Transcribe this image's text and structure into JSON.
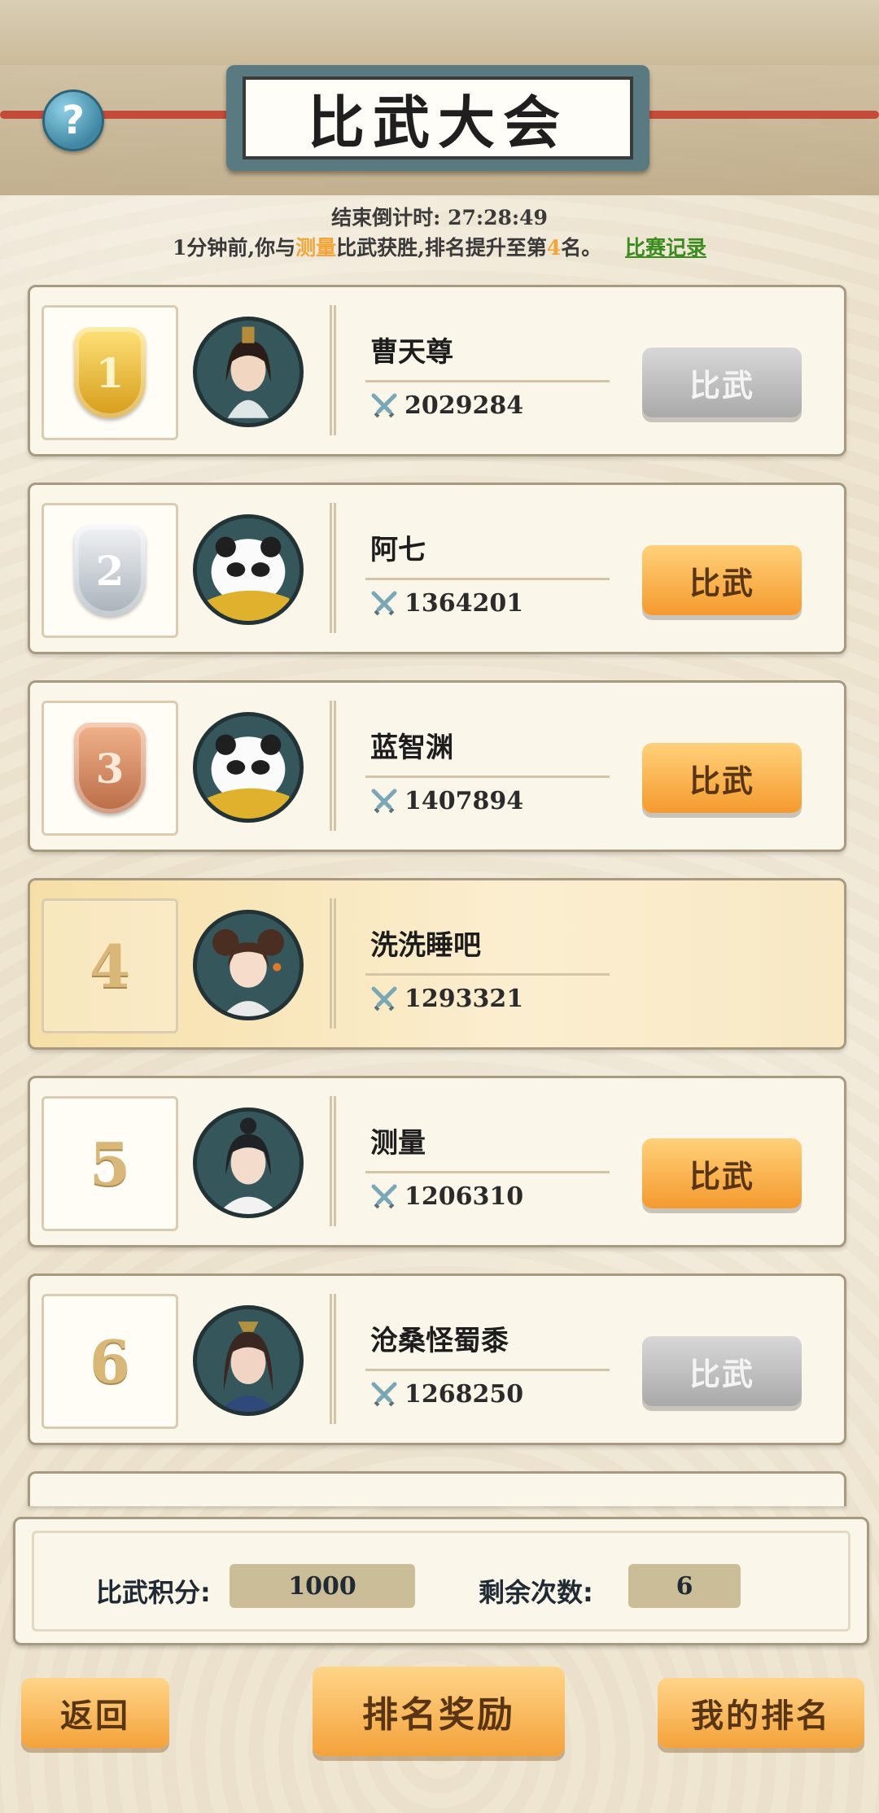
{
  "header": {
    "title": "比武大会",
    "help_icon": "?"
  },
  "countdown": {
    "label": "结束倒计时:",
    "time": "27:28:49"
  },
  "news": {
    "prefix": "1分钟前,你与",
    "opponent": "测量",
    "middle": "比武获胜,排名提升至第",
    "rank": "4",
    "suffix": "名。",
    "link": "比赛记录"
  },
  "ranking": [
    {
      "rank": "1",
      "medal": "gold",
      "name": "曹天尊",
      "power": "2029284",
      "button": "比武",
      "button_state": "disabled",
      "avatar": "swordsman-topknot"
    },
    {
      "rank": "2",
      "medal": "silver",
      "name": "阿七",
      "power": "1364201",
      "button": "比武",
      "button_state": "active",
      "avatar": "panda-yellow-scarf"
    },
    {
      "rank": "3",
      "medal": "bronze",
      "name": "蓝智渊",
      "power": "1407894",
      "button": "比武",
      "button_state": "active",
      "avatar": "panda-yellow-scarf"
    },
    {
      "rank": "4",
      "medal": "none",
      "name": "洗洗睡吧",
      "power": "1293321",
      "button": "",
      "button_state": "self",
      "avatar": "girl-buns"
    },
    {
      "rank": "5",
      "medal": "none",
      "name": "测量",
      "power": "1206310",
      "button": "比武",
      "button_state": "active",
      "avatar": "scholar-white-robe"
    },
    {
      "rank": "6",
      "medal": "none",
      "name": "沧桑怪蜀黍",
      "power": "1268250",
      "button": "比武",
      "button_state": "disabled",
      "avatar": "lady-hair-ornament"
    }
  ],
  "stats": {
    "points_label": "比武积分:",
    "points_value": "1000",
    "remaining_label": "剩余次数:",
    "remaining_value": "6"
  },
  "buttons": {
    "back": "返回",
    "rewards": "排名奖励",
    "my_rank": "我的排名"
  }
}
